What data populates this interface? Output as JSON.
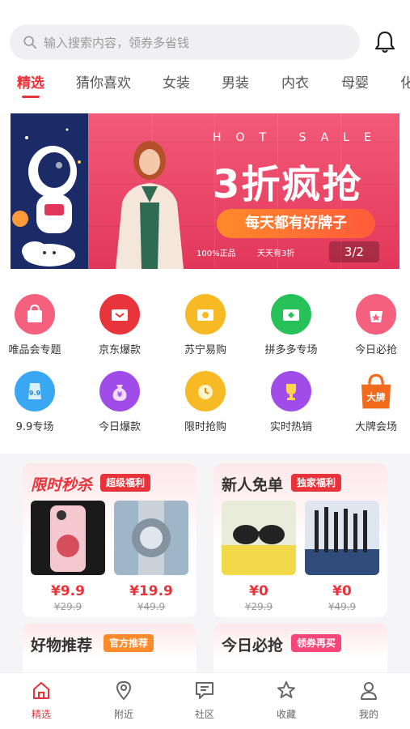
{
  "search": {
    "placeholder": "输入搜索内容，领券多省钱"
  },
  "tabs": [
    "精选",
    "猜你喜欢",
    "女装",
    "男装",
    "内衣",
    "母婴",
    "化"
  ],
  "banner": {
    "hot_text": "HOT SALE",
    "headline": "3折疯抢",
    "slogan": "每天都有好牌子",
    "guarantee_1": "100%正品",
    "guarantee_2": "天天有3折",
    "pager": "3/2"
  },
  "categories": [
    {
      "label": "唯品会专题",
      "icon": "vip-bag-icon",
      "color": "#f4607e"
    },
    {
      "label": "京东爆款",
      "icon": "jd-icon",
      "color": "#e8343b"
    },
    {
      "label": "苏宁易购",
      "icon": "suning-icon",
      "color": "#f7b924"
    },
    {
      "label": "拼多多专场",
      "icon": "pdd-icon",
      "color": "#27c15a"
    },
    {
      "label": "今日必抢",
      "icon": "star-bag-icon",
      "color": "#f4607e"
    },
    {
      "label": "9.9专场",
      "icon": "price-tag-icon",
      "color": "#3aa7f2"
    },
    {
      "label": "今日爆款",
      "icon": "money-bag-icon",
      "color": "#a04ce8"
    },
    {
      "label": "限时抢购",
      "icon": "alarm-clock-icon",
      "color": "#f7b924"
    },
    {
      "label": "实时热销",
      "icon": "trophy-icon",
      "color": "#a04ce8"
    },
    {
      "label": "大牌会场",
      "icon": "shopping-bag-icon",
      "color": "#f26a1c"
    }
  ],
  "cards": {
    "flash": {
      "title": "限时秒杀",
      "badge": "超级福利",
      "items": [
        {
          "price": "¥9.9",
          "orig": "¥29.9"
        },
        {
          "price": "¥19.9",
          "orig": "¥49.9"
        }
      ]
    },
    "newuser": {
      "title": "新人免单",
      "badge": "独家福利",
      "items": [
        {
          "price": "¥0",
          "orig": "¥29.9"
        },
        {
          "price": "¥0",
          "orig": "¥49.9"
        }
      ]
    },
    "goods": {
      "title": "好物推荐",
      "badge": "官方推荐"
    },
    "today": {
      "title": "今日必抢",
      "badge": "领券再买"
    }
  },
  "nav": [
    "精选",
    "附近",
    "社区",
    "收藏",
    "我的"
  ],
  "colors": {
    "accent": "#e9333a"
  }
}
